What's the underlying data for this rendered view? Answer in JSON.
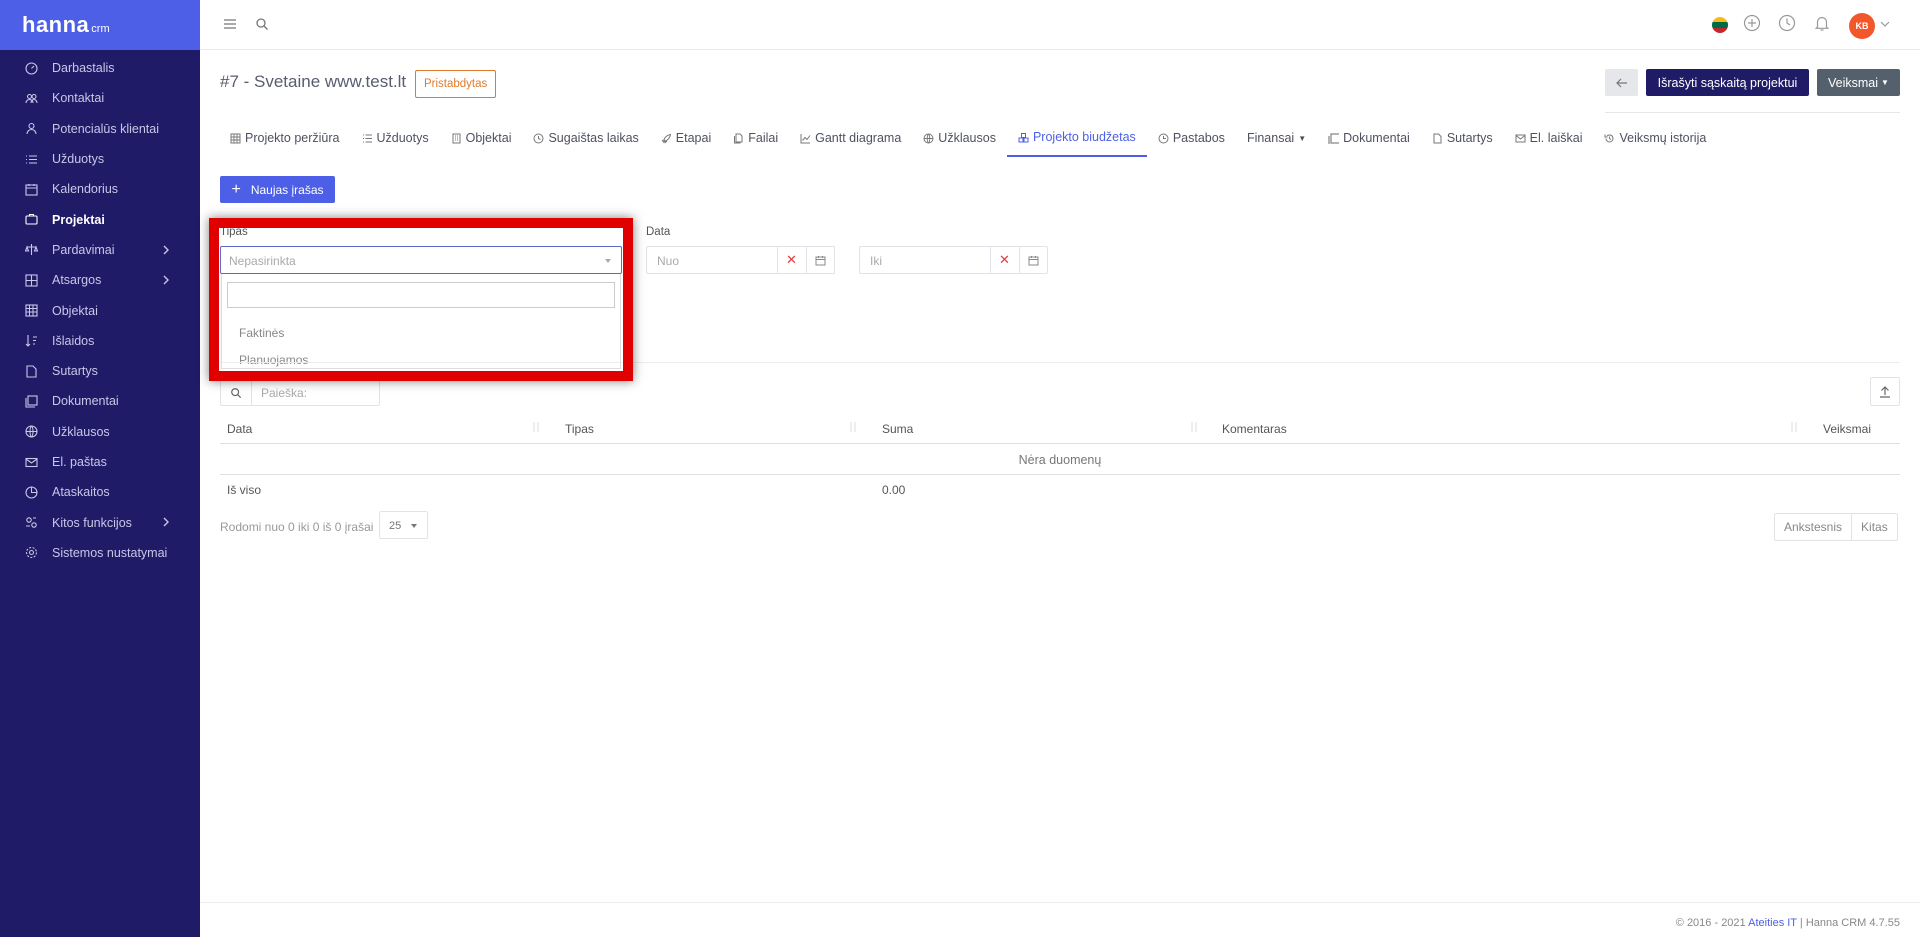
{
  "app": {
    "brand": "hanna",
    "brand_suffix": "crm"
  },
  "sidebar": {
    "items": [
      {
        "label": "Darbastalis",
        "icon": "dashboard-icon"
      },
      {
        "label": "Kontaktai",
        "icon": "contacts-icon"
      },
      {
        "label": "Potencialūs klientai",
        "icon": "leads-icon"
      },
      {
        "label": "Užduotys",
        "icon": "tasks-icon"
      },
      {
        "label": "Kalendorius",
        "icon": "calendar-icon"
      },
      {
        "label": "Projektai",
        "icon": "projects-icon",
        "active": true
      },
      {
        "label": "Pardavimai",
        "icon": "sales-icon",
        "has_submenu": true
      },
      {
        "label": "Atsargos",
        "icon": "inventory-icon",
        "has_submenu": true
      },
      {
        "label": "Objektai",
        "icon": "objects-icon"
      },
      {
        "label": "Išlaidos",
        "icon": "expenses-icon"
      },
      {
        "label": "Sutartys",
        "icon": "contracts-icon"
      },
      {
        "label": "Dokumentai",
        "icon": "documents-icon"
      },
      {
        "label": "Užklausos",
        "icon": "inquiries-icon"
      },
      {
        "label": "El. paštas",
        "icon": "email-icon"
      },
      {
        "label": "Ataskaitos",
        "icon": "reports-icon"
      },
      {
        "label": "Kitos funkcijos",
        "icon": "other-functions-icon",
        "has_submenu": true
      },
      {
        "label": "Sistemos nustatymai",
        "icon": "settings-icon"
      }
    ]
  },
  "topbar": {
    "menu_icon": "hamburger-menu-icon",
    "search_icon": "search-icon",
    "language_flag": "lithuania-flag-icon",
    "avatar_initials": "KB"
  },
  "header": {
    "title": "#7 - Svetaine www.test.lt",
    "status": "Pristabdytas",
    "invoice_button": "Išrašyti sąskaitą projektui",
    "actions_button": "Veiksmai"
  },
  "tabs": [
    {
      "label": "Projekto peržiūra",
      "icon": "table-icon"
    },
    {
      "label": "Užduotys",
      "icon": "list-icon"
    },
    {
      "label": "Objektai",
      "icon": "building-icon"
    },
    {
      "label": "Sugaištas laikas",
      "icon": "clock-icon"
    },
    {
      "label": "Etapai",
      "icon": "rocket-icon"
    },
    {
      "label": "Failai",
      "icon": "files-icon"
    },
    {
      "label": "Gantt diagrama",
      "icon": "chart-icon"
    },
    {
      "label": "Užklausos",
      "icon": "globe-icon"
    },
    {
      "label": "Projekto biudžetas",
      "icon": "budget-icon",
      "active": true
    },
    {
      "label": "Pastabos",
      "icon": "notes-clock-icon"
    },
    {
      "label": "Finansai",
      "icon": "",
      "dropdown": true
    },
    {
      "label": "Dokumentai",
      "icon": "documents-icon"
    },
    {
      "label": "Sutartys",
      "icon": "file-icon"
    },
    {
      "label": "El. laiškai",
      "icon": "envelope-icon"
    },
    {
      "label": "Veiksmų istorija",
      "icon": "history-icon"
    }
  ],
  "new_button": "Naujas įrašas",
  "filters": {
    "type_label": "Tipas",
    "type_placeholder": "Nepasirinkta",
    "type_options": [
      "Faktinės",
      "Planuojamos"
    ],
    "date_label": "Data",
    "date_from_placeholder": "Nuo",
    "date_to_placeholder": "Iki"
  },
  "table": {
    "search_placeholder": "Paieška:",
    "columns": [
      "Data",
      "Tipas",
      "Suma",
      "Komentaras",
      "Veiksmai"
    ],
    "empty_text": "Nėra duomenų",
    "footer_label": "Iš viso",
    "footer_total": "0.00",
    "info": "Rodomi nuo 0 iki 0 iš 0 įrašai",
    "page_size": "25",
    "prev": "Ankstesnis",
    "next": "Kitas"
  },
  "footer": {
    "copyright": "© 2016 - 2021",
    "company": "Ateities IT",
    "separator": "|",
    "product": "Hanna CRM 4.7.55"
  },
  "colors": {
    "sidebar_bg": "#1f1b66",
    "accent": "#4d5fe6",
    "status_orange": "#e07b2e",
    "highlight_red": "#e10000",
    "avatar_bg": "#f2572c"
  }
}
